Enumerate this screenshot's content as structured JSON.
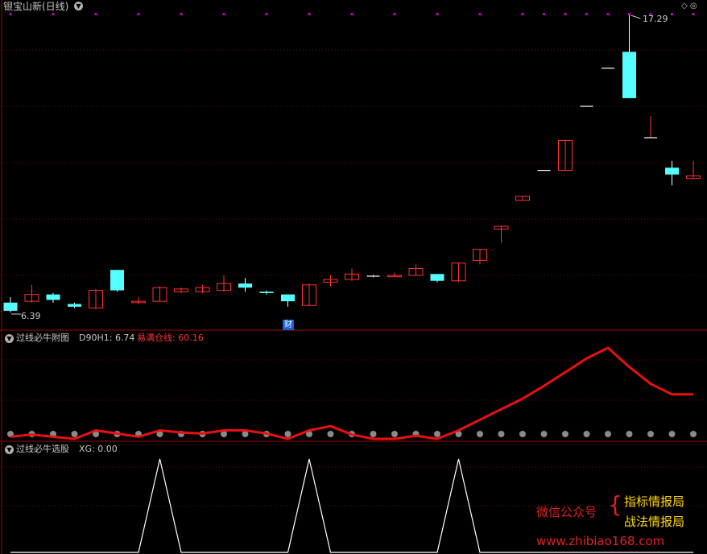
{
  "header": {
    "title": "银宝山新(日线)"
  },
  "main_chart": {
    "high_label": "17.29",
    "low_label": "6.39",
    "event_badge": "财"
  },
  "indicator1": {
    "name": "过线必牛附图",
    "field1_label": "D90H1: 6.74",
    "field2_label": "易满仓线: 60.16"
  },
  "indicator2": {
    "name": "过线必牛选股",
    "field1_label": "XG: 0.00"
  },
  "watermark": {
    "left": "微信公众号",
    "right_top": "指标情报局",
    "right_bottom": "战法情报局",
    "url": "www.zhibiao168.com"
  },
  "colors": {
    "up": "#ff3232",
    "down": "#54ffff",
    "dots": "#c000c0",
    "grid": "#8b0000",
    "signal": "#ffffff"
  },
  "chart_data": [
    {
      "type": "candlestick",
      "title": "银宝山新(日线)",
      "candles": [
        {
          "o": 6.75,
          "c": 6.45,
          "h": 6.95,
          "l": 6.39
        },
        {
          "o": 6.8,
          "c": 7.05,
          "h": 7.4,
          "l": 6.75
        },
        {
          "o": 7.05,
          "c": 6.85,
          "h": 7.1,
          "l": 6.75
        },
        {
          "o": 6.7,
          "c": 6.6,
          "h": 6.75,
          "l": 6.55
        },
        {
          "o": 6.55,
          "c": 7.2,
          "h": 7.25,
          "l": 6.5
        },
        {
          "o": 7.95,
          "c": 7.2,
          "h": 7.95,
          "l": 7.15
        },
        {
          "o": 6.75,
          "c": 6.8,
          "h": 6.95,
          "l": 6.7
        },
        {
          "o": 6.8,
          "c": 7.3,
          "h": 7.35,
          "l": 6.8
        },
        {
          "o": 7.15,
          "c": 7.25,
          "h": 7.3,
          "l": 7.1
        },
        {
          "o": 7.15,
          "c": 7.3,
          "h": 7.4,
          "l": 7.1
        },
        {
          "o": 7.2,
          "c": 7.45,
          "h": 7.75,
          "l": 7.15
        },
        {
          "o": 7.45,
          "c": 7.3,
          "h": 7.65,
          "l": 7.15
        },
        {
          "o": 7.15,
          "c": 7.1,
          "h": 7.2,
          "l": 7.05
        },
        {
          "o": 7.05,
          "c": 6.8,
          "h": 7.05,
          "l": 6.6
        },
        {
          "o": 6.65,
          "c": 7.4,
          "h": 7.45,
          "l": 6.65
        },
        {
          "o": 7.5,
          "c": 7.6,
          "h": 7.75,
          "l": 7.35
        },
        {
          "o": 7.6,
          "c": 7.8,
          "h": 8.0,
          "l": 7.55
        },
        {
          "o": 7.7,
          "c": 7.72,
          "h": 7.8,
          "l": 7.65
        },
        {
          "o": 7.7,
          "c": 7.75,
          "h": 7.85,
          "l": 7.7
        },
        {
          "o": 7.75,
          "c": 8.0,
          "h": 8.15,
          "l": 7.75
        },
        {
          "o": 7.8,
          "c": 7.55,
          "h": 7.8,
          "l": 7.5
        },
        {
          "o": 7.55,
          "c": 8.2,
          "h": 8.2,
          "l": 7.5
        },
        {
          "o": 8.3,
          "c": 8.7,
          "h": 8.7,
          "l": 8.15
        },
        {
          "o": 9.45,
          "c": 9.55,
          "h": 9.55,
          "l": 8.95
        },
        {
          "o": 10.5,
          "c": 10.65,
          "h": 10.65,
          "l": 10.5
        },
        {
          "o": 11.6,
          "c": 11.6,
          "h": 11.6,
          "l": 11.6
        },
        {
          "o": 11.6,
          "c": 12.7,
          "h": 12.7,
          "l": 11.6
        },
        {
          "o": 13.95,
          "c": 13.95,
          "h": 13.95,
          "l": 13.95
        },
        {
          "o": 15.35,
          "c": 15.35,
          "h": 15.35,
          "l": 15.35
        },
        {
          "o": 15.95,
          "c": 14.25,
          "h": 17.29,
          "l": 14.25
        },
        {
          "o": 12.8,
          "c": 12.8,
          "h": 13.6,
          "l": 12.8
        },
        {
          "o": 11.7,
          "c": 11.45,
          "h": 11.95,
          "l": 11.05
        },
        {
          "o": 11.3,
          "c": 11.4,
          "h": 11.95,
          "l": 11.3
        }
      ]
    },
    {
      "type": "line",
      "title": "过线必牛附图",
      "series": [
        {
          "name": "易满仓线",
          "values": [
            2,
            4,
            2,
            0,
            8,
            5,
            2,
            8,
            6,
            5,
            8,
            8,
            5,
            0,
            8,
            12,
            4,
            0,
            0,
            3,
            0,
            8,
            18,
            28,
            38,
            50,
            63,
            76,
            86,
            68,
            52,
            42,
            42
          ]
        }
      ]
    },
    {
      "type": "line",
      "title": "过线必牛选股",
      "series": [
        {
          "name": "XG",
          "values": [
            0,
            0,
            0,
            0,
            0,
            0,
            0,
            1,
            0,
            0,
            0,
            0,
            0,
            0,
            1,
            0,
            0,
            0,
            0,
            0,
            0,
            1,
            0,
            0,
            0,
            0,
            0,
            0,
            0,
            0,
            0,
            0,
            0
          ]
        }
      ]
    }
  ]
}
